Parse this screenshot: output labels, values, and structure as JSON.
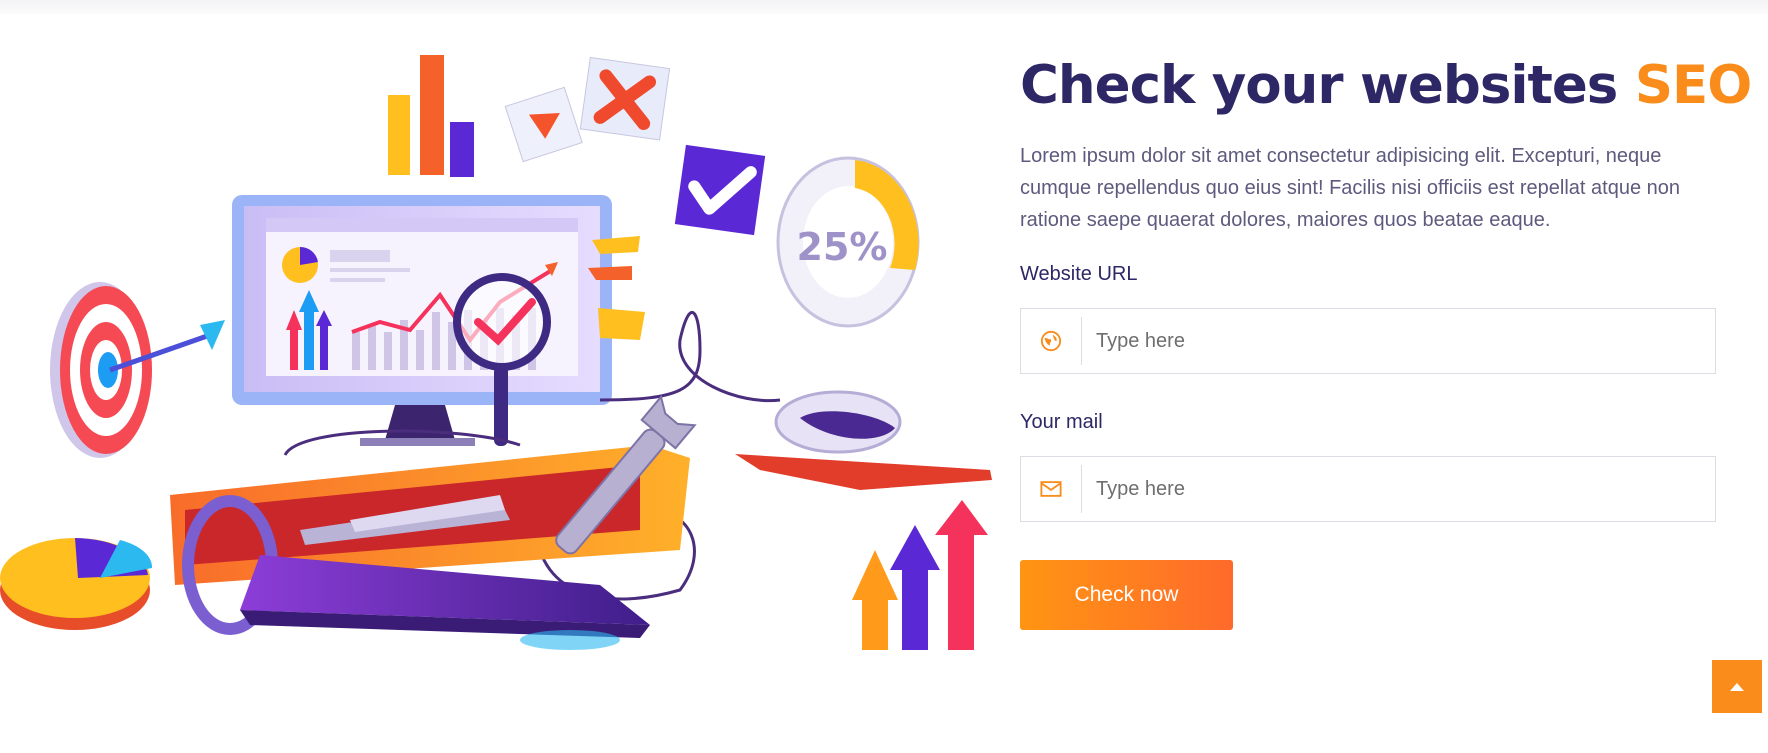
{
  "hero": {
    "title_main": "Check your websites ",
    "title_accent": "SEO",
    "description": "Lorem ipsum dolor sit amet consectetur adipisicing elit. Excepturi, neque cumque repellendus quo eius sint! Facilis nisi officiis est repellat atque non ratione saepe quaerat dolores, maiores quos beatae eaque."
  },
  "illustration": {
    "percent_label": "25%"
  },
  "form": {
    "url_label": "Website URL",
    "url_placeholder": "Type here",
    "url_icon": "globe-icon",
    "mail_label": "Your mail",
    "mail_placeholder": "Type here",
    "mail_icon": "envelope-icon",
    "submit_label": "Check now"
  },
  "scroll_top": {
    "icon": "caret-up-icon"
  },
  "colors": {
    "navy": "#2d2766",
    "accent": "#fa8c1c",
    "text_muted": "#5e5a7d",
    "button_start": "#ff9513",
    "button_end": "#ff6a2b"
  }
}
